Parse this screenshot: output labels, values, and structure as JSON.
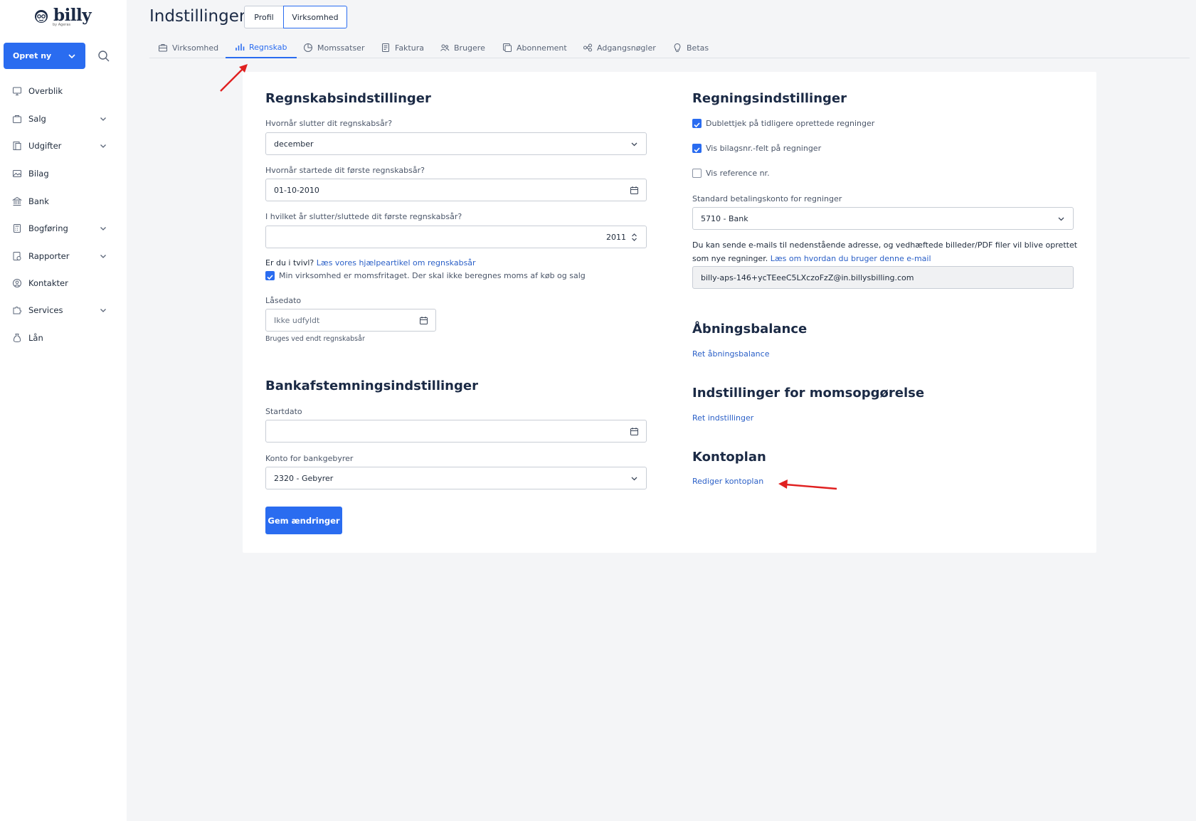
{
  "brand": {
    "logo_text": "billy",
    "logo_sub": "by Ageras"
  },
  "sidebar": {
    "create_label": "Opret ny",
    "items": [
      {
        "label": "Overblik",
        "icon": "monitor-icon",
        "chevron": false
      },
      {
        "label": "Salg",
        "icon": "shop-icon",
        "chevron": true
      },
      {
        "label": "Udgifter",
        "icon": "receipt-icon",
        "chevron": true
      },
      {
        "label": "Bilag",
        "icon": "image-icon",
        "chevron": false
      },
      {
        "label": "Bank",
        "icon": "bank-icon",
        "chevron": false
      },
      {
        "label": "Bogføring",
        "icon": "calculator-icon",
        "chevron": true
      },
      {
        "label": "Rapporter",
        "icon": "report-icon",
        "chevron": true
      },
      {
        "label": "Kontakter",
        "icon": "user-circle-icon",
        "chevron": false
      },
      {
        "label": "Services",
        "icon": "puzzle-icon",
        "chevron": true
      },
      {
        "label": "Lån",
        "icon": "money-bag-icon",
        "chevron": false
      }
    ]
  },
  "header": {
    "title": "Indstillinger",
    "segments": [
      "Profil",
      "Virksomhed"
    ],
    "selected_segment": "Virksomhed"
  },
  "tabs": [
    {
      "label": "Virksomhed",
      "icon": "briefcase-icon"
    },
    {
      "label": "Regnskab",
      "icon": "bar-chart-icon",
      "active": true
    },
    {
      "label": "Momssatser",
      "icon": "pie-icon"
    },
    {
      "label": "Faktura",
      "icon": "document-icon"
    },
    {
      "label": "Brugere",
      "icon": "users-icon"
    },
    {
      "label": "Abonnement",
      "icon": "copy-icon"
    },
    {
      "label": "Adgangsnøgler",
      "icon": "key-icon"
    },
    {
      "label": "Betas",
      "icon": "bulb-icon"
    }
  ],
  "accounting": {
    "title": "Regnskabsindstillinger",
    "year_end_label": "Hvornår slutter dit regnskabsår?",
    "year_end_value": "december",
    "first_start_label": "Hvornår startede dit første regnskabsår?",
    "first_start_value": "01-10-2010",
    "first_end_label": "I hvilket år slutter/sluttede dit første regnskabsår?",
    "first_end_value": "2011",
    "doubt_text": "Er du i tvivl?",
    "doubt_link": "Læs vores hjælpeartikel om regnskabsår",
    "vat_exempt_label": "Min virksomhed er momsfritaget. Der skal ikke beregnes moms af køb og salg",
    "vat_exempt_checked": true,
    "lock_label": "Låsedato",
    "lock_placeholder": "Ikke udfyldt",
    "lock_help": "Bruges ved endt regnskabsår"
  },
  "bank": {
    "title": "Bankafstemningsindstillinger",
    "start_label": "Startdato",
    "start_value": "",
    "fee_label": "Konto for bankgebyrer",
    "fee_value": "2320 - Gebyrer"
  },
  "save_label": "Gem ændringer",
  "bills": {
    "title": "Regningsindstillinger",
    "checks": [
      {
        "label": "Dublettjek på tidligere oprettede regninger",
        "checked": true
      },
      {
        "label": "Vis bilagsnr.-felt på regninger",
        "checked": true
      },
      {
        "label": "Vis reference nr.",
        "checked": false
      }
    ],
    "account_label": "Standard betalingskonto for regninger",
    "account_value": "5710 - Bank",
    "email_text_1": "Du kan sende e-mails til nedenstående adresse, og vedhæftede billeder/PDF filer vil blive oprettet",
    "email_text_2": "som nye regninger.",
    "email_link": "Læs om hvordan du bruger denne e-mail",
    "email_value": "billy-aps-146+ycTEeeC5LXczoFzZ@in.billysbilling.com"
  },
  "opening": {
    "title": "Åbningsbalance",
    "link": "Ret åbningsbalance"
  },
  "vat_report": {
    "title": "Indstillinger for momsopgørelse",
    "link": "Ret indstillinger"
  },
  "chart_of_accounts": {
    "title": "Kontoplan",
    "link": "Rediger kontoplan"
  },
  "colors": {
    "accent": "#2a6cf0",
    "annotation": "#e02020",
    "link": "#2a5fc7"
  }
}
